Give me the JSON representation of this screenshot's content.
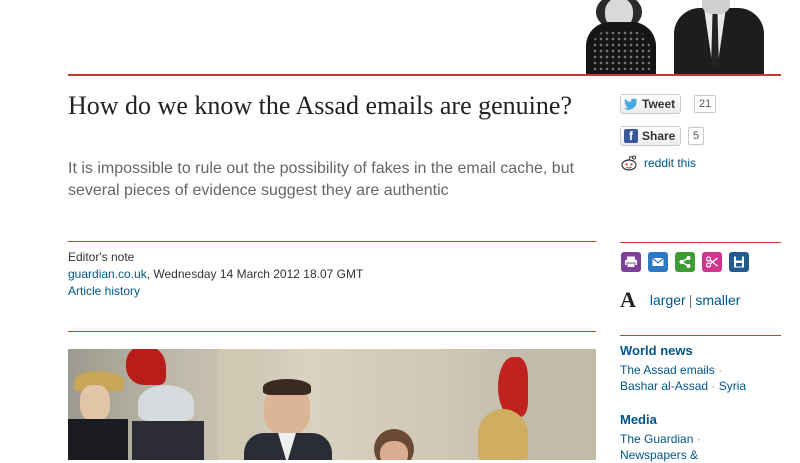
{
  "article": {
    "headline": "How do we know the Assad emails are genuine?",
    "standfirst": "It is impossible to rule out the possibility of fakes in the email cache, but several pieces of evidence suggest they are authentic",
    "meta": {
      "label": "Editor's note",
      "source": "guardian.co.uk",
      "dateline": ", Wednesday 14 March 2012 18.07 GMT",
      "history_link": "Article history"
    }
  },
  "share": {
    "tweet_label": "Tweet",
    "tweet_count": "21",
    "facebook_label": "Share",
    "facebook_count": "5",
    "reddit_label": "reddit this"
  },
  "text_size": {
    "glyph": "A",
    "larger": "larger",
    "separator": "|",
    "smaller": "smaller"
  },
  "sidebar": {
    "world_news_heading": "World news",
    "world_news_links": [
      "The Assad emails",
      "Bashar al-Assad",
      "Syria"
    ],
    "media_heading": "Media",
    "media_links": [
      "The Guardian",
      "Newspapers &"
    ]
  },
  "icons": [
    "print-icon",
    "email-icon",
    "share-icon",
    "clip-icon",
    "save-icon"
  ],
  "colors": {
    "accent_red": "#c8392f",
    "link_blue": "#005689",
    "tool_purple": "#7d3f98",
    "tool_blue": "#2e77c2",
    "tool_green": "#3f9c35",
    "tool_pink": "#d1368f",
    "tool_navy": "#225b8d"
  }
}
